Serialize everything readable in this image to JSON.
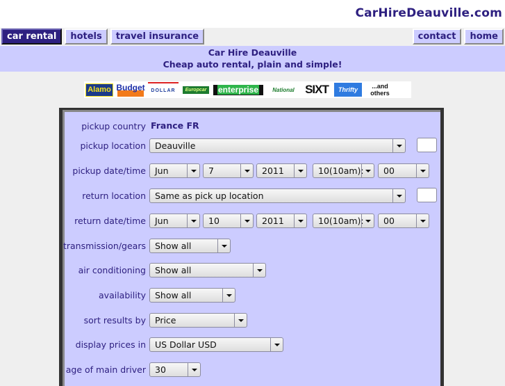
{
  "site": {
    "title": "CarHireDeauville.com"
  },
  "nav": {
    "left": [
      {
        "label": "car rental",
        "active": true
      },
      {
        "label": "hotels",
        "active": false
      },
      {
        "label": "travel insurance",
        "active": false
      }
    ],
    "right": [
      {
        "label": "contact"
      },
      {
        "label": "home"
      }
    ]
  },
  "banner": {
    "line1": "Car Hire Deauville",
    "line2": "Cheap auto rental, plain and simple!"
  },
  "logos": {
    "alamo": "Alamo",
    "budget": "Budget",
    "dollar": "DOLLAR",
    "europcar": "Europcar",
    "enterprise": "enterprise",
    "national": "National",
    "sixt": "SIXT",
    "thrifty": "Thrifty",
    "others": "...and others"
  },
  "form": {
    "pickup_country": {
      "label": "pickup country",
      "value": "France FR"
    },
    "pickup_location": {
      "label": "pickup location",
      "value": "Deauville",
      "code": ""
    },
    "pickup_datetime": {
      "label": "pickup date/time",
      "month": "Jun",
      "day": "7",
      "year": "2011",
      "hour": "10(10am):",
      "minute": "00"
    },
    "return_location": {
      "label": "return location",
      "value": "Same as pick up location",
      "code": ""
    },
    "return_datetime": {
      "label": "return date/time",
      "month": "Jun",
      "day": "10",
      "year": "2011",
      "hour": "10(10am):",
      "minute": "00"
    },
    "transmission": {
      "label": "transmission/gears",
      "value": "Show all"
    },
    "air_conditioning": {
      "label": "air conditioning",
      "value": "Show all"
    },
    "availability": {
      "label": "availability",
      "value": "Show all"
    },
    "sort_by": {
      "label": "sort results by",
      "value": "Price"
    },
    "currency": {
      "label": "display prices in",
      "value": "US Dollar USD"
    },
    "driver_age": {
      "label": "age of main driver",
      "value": "30"
    }
  }
}
